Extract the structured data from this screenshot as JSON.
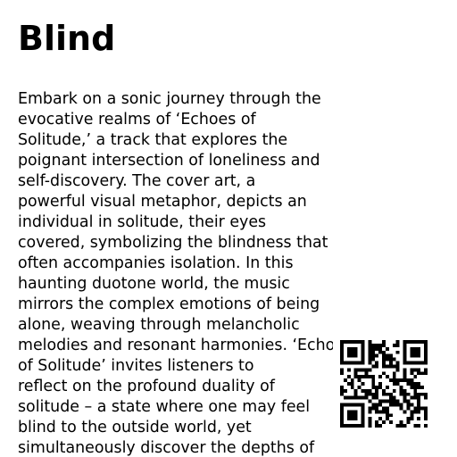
{
  "title": "Blind",
  "description_lines": [
    "Embark on a sonic journey through the",
    "evocative realms of ‘Echoes of",
    "Solitude,’ a track that explores the",
    "poignant intersection of loneliness and",
    "self-discovery. The cover art, a",
    "powerful visual metaphor, depicts an",
    "individual in solitude, their eyes",
    "covered, symbolizing the blindness that",
    "often accompanies isolation. In this",
    "haunting duotone world, the music",
    "mirrors the complex emotions of being",
    "alone, weaving through melancholic",
    "melodies and resonant harmonies. ‘Echoes",
    "of Solitude’ invites listeners to",
    "reflect on the profound duality of",
    "solitude – a state where one may feel",
    "blind to the outside world, yet",
    "simultaneously discover the depths of"
  ],
  "qr_code": {
    "icon": "qr-code-icon",
    "foreground": "#000000",
    "background": "#ffffff"
  }
}
